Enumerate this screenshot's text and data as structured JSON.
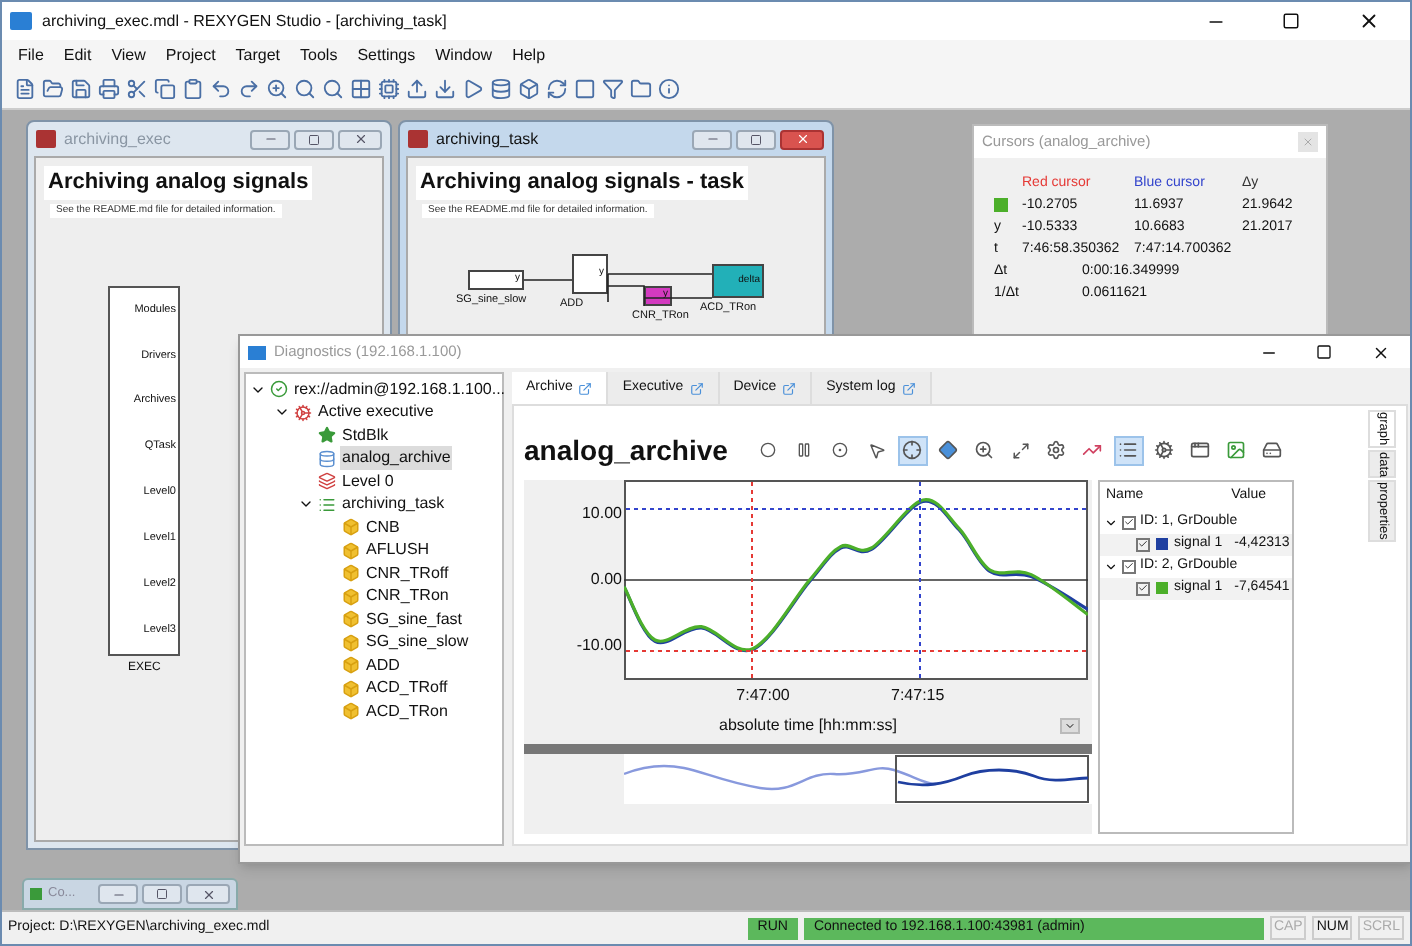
{
  "window": {
    "title": "archiving_exec.mdl - REXYGEN Studio - [archiving_task]"
  },
  "menu": [
    "File",
    "Edit",
    "View",
    "Project",
    "Target",
    "Tools",
    "Settings",
    "Window",
    "Help"
  ],
  "mdi_windows": [
    {
      "title": "archiving_exec",
      "active": false,
      "heading": "Archiving analog signals",
      "note": "See the README.md file for detailed information.",
      "exec_block": {
        "ports": [
          "Modules",
          "Drivers",
          "Archives",
          "QTask",
          "Level0",
          "Level1",
          "Level2",
          "Level3"
        ],
        "label": "EXEC"
      }
    },
    {
      "title": "archiving_task",
      "active": true,
      "heading": "Archiving analog signals - task",
      "note": "See the README.md file for detailed information.",
      "blocks": [
        {
          "kind": "source",
          "label": "SG_sine_slow",
          "inner": "y"
        },
        {
          "kind": "sum",
          "label": "ADD",
          "inner": "y"
        },
        {
          "kind": "gain",
          "label": "CNR_TRon",
          "inner": "y"
        },
        {
          "kind": "delta",
          "label": "ACD_TRon",
          "inner": "delta"
        }
      ]
    }
  ],
  "cursors_window": {
    "title": "Cursors (analog_archive)",
    "columns": [
      {
        "label": "Red cursor",
        "color": "#e53935"
      },
      {
        "label": "Blue cursor",
        "color": "#3344cc"
      },
      {
        "label": "Δy",
        "color": "#333333"
      }
    ],
    "rows": [
      {
        "kind": "swatch",
        "color": "#4caf2a",
        "cells": [
          "-10.2705",
          "11.6937",
          "21.9642"
        ]
      },
      {
        "kind": "plain",
        "label": "y",
        "cells": [
          "-10.5333",
          "10.6683",
          "21.2017"
        ]
      },
      {
        "kind": "plain",
        "label": "t",
        "cells": [
          "7:46:58.350362",
          "7:47:14.700362"
        ]
      },
      {
        "kind": "span",
        "label": "Δt",
        "cells": [
          "0:00:16.349999"
        ]
      },
      {
        "kind": "span",
        "label": "1/Δt",
        "cells": [
          "0.0611621"
        ]
      }
    ]
  },
  "diagnostics": {
    "title": "Diagnostics (192.168.1.100)",
    "tree": [
      {
        "kind": "target",
        "label": "rex://admin@192.168.1.100...",
        "selected": false,
        "expanded": true,
        "children": [
          {
            "kind": "executive",
            "label": "Active executive",
            "selected": false,
            "expanded": true,
            "children": [
              {
                "kind": "module",
                "label": "StdBlk",
                "selected": false
              },
              {
                "kind": "archive",
                "label": "analog_archive",
                "selected": true
              },
              {
                "kind": "level",
                "label": "Level 0",
                "selected": false
              },
              {
                "kind": "task",
                "label": "archiving_task",
                "selected": false,
                "expanded": true,
                "children": [
                  {
                    "kind": "block",
                    "label": "CNB",
                    "selected": false
                  },
                  {
                    "kind": "block",
                    "label": "AFLUSH",
                    "selected": false
                  },
                  {
                    "kind": "block",
                    "label": "CNR_TRoff",
                    "selected": false
                  },
                  {
                    "kind": "block",
                    "label": "CNR_TRon",
                    "selected": false
                  },
                  {
                    "kind": "block",
                    "label": "SG_sine_fast",
                    "selected": false
                  },
                  {
                    "kind": "block",
                    "label": "SG_sine_slow",
                    "selected": false
                  },
                  {
                    "kind": "block",
                    "label": "ADD",
                    "selected": false
                  },
                  {
                    "kind": "block",
                    "label": "ACD_TRoff",
                    "selected": false
                  },
                  {
                    "kind": "block",
                    "label": "ACD_TRon",
                    "selected": false
                  }
                ]
              }
            ]
          }
        ]
      }
    ],
    "tabs": [
      {
        "label": "Archive",
        "selected": true
      },
      {
        "label": "Executive",
        "selected": false
      },
      {
        "label": "Device",
        "selected": false
      },
      {
        "label": "System log",
        "selected": false
      }
    ],
    "archive": {
      "title": "analog_archive",
      "tools": [
        {
          "kind": "stop",
          "pressed": false
        },
        {
          "kind": "pause",
          "pressed": false
        },
        {
          "kind": "record",
          "pressed": false
        },
        {
          "kind": "pointer",
          "pressed": false
        },
        {
          "kind": "cursor",
          "pressed": true
        },
        {
          "kind": "diamond",
          "pressed": false
        },
        {
          "kind": "zoom",
          "pressed": false
        },
        {
          "kind": "fit",
          "pressed": false
        },
        {
          "kind": "settings",
          "pressed": false
        },
        {
          "kind": "trend",
          "pressed": false
        },
        {
          "kind": "list",
          "pressed": true
        },
        {
          "kind": "gear",
          "pressed": false
        },
        {
          "kind": "window",
          "pressed": false
        },
        {
          "kind": "image",
          "pressed": false
        },
        {
          "kind": "disk",
          "pressed": false
        }
      ],
      "chart_data": {
        "type": "line",
        "xlabel": "absolute time [hh:mm:ss]",
        "x": [
          28006,
          28009,
          28013.5,
          28018.5,
          28024,
          28027,
          28030,
          28035,
          28038.5,
          28041.5,
          28045.5,
          28051
        ],
        "series": [
          {
            "name": "signal 1",
            "color": "#1f3fa0",
            "values": [
              -1,
              -9.2,
              -7.2,
              -10.4,
              -0.2,
              4.8,
              4.6,
              11.8,
              7.5,
              1.3,
              0.5,
              -4.4
            ]
          },
          {
            "name": "signal 1",
            "color": "#4caf2a",
            "values": [
              -1,
              -9,
              -7,
              -10.3,
              0,
              5,
              4.8,
              12,
              7.7,
              1.5,
              0.8,
              -5.2
            ]
          }
        ],
        "xlim": [
          28006,
          28051
        ],
        "ylim": [
          -15,
          15
        ],
        "xticks": [
          {
            "value": 28020,
            "label": "7:47:00"
          },
          {
            "value": 28035,
            "label": "7:47:15"
          }
        ],
        "yticks": [
          {
            "value": 10,
            "label": "10.00"
          },
          {
            "value": 0,
            "label": "0.00"
          },
          {
            "value": -10,
            "label": "-10.00"
          }
        ]
      },
      "legend": {
        "columns": [
          "Name",
          "Value"
        ],
        "groups": [
          {
            "label": "ID: 1, GrDouble",
            "checked": true,
            "expanded": true,
            "children": [
              {
                "checked": true,
                "value": "-4,42313"
              }
            ]
          },
          {
            "label": "ID: 2, GrDouble",
            "checked": true,
            "expanded": true,
            "children": [
              {
                "checked": true,
                "value": "-7,64541"
              }
            ]
          }
        ]
      },
      "side_tabs": [
        {
          "label": "graph",
          "selected": true
        },
        {
          "label": "data",
          "selected": false
        },
        {
          "label": "properties",
          "selected": false
        }
      ]
    }
  },
  "minimized_window": {
    "title": "Co..."
  },
  "status_bar": {
    "project": "Project: D:\\REXYGEN\\archiving_exec.mdl",
    "run": "RUN",
    "connection": "Connected to 192.168.1.100:43981 (admin)",
    "indicators": [
      {
        "label": "CAP",
        "on": false
      },
      {
        "label": "NUM",
        "on": true
      },
      {
        "label": "SCRL",
        "on": false
      }
    ]
  }
}
